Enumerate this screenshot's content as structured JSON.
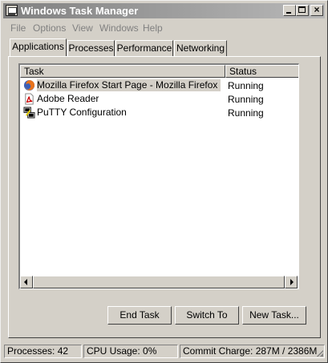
{
  "window": {
    "title": "Windows Task Manager"
  },
  "menu": [
    "File",
    "Options",
    "View",
    "Windows",
    "Help"
  ],
  "tabs": [
    "Applications",
    "Processes",
    "Performance",
    "Networking"
  ],
  "active_tab": "Applications",
  "list": {
    "columns": [
      "Task",
      "Status"
    ],
    "rows": [
      {
        "task": "Mozilla Firefox Start Page - Mozilla Firefox",
        "status": "Running",
        "icon": "firefox-icon",
        "selected": true
      },
      {
        "task": "Adobe Reader",
        "status": "Running",
        "icon": "adobe-reader-icon",
        "selected": false
      },
      {
        "task": "PuTTY Configuration",
        "status": "Running",
        "icon": "putty-icon",
        "selected": false
      }
    ]
  },
  "buttons": {
    "end_task": "End Task",
    "switch_to": "Switch To",
    "new_task": "New Task..."
  },
  "statusbar": {
    "processes": "Processes: 42",
    "cpu": "CPU Usage: 0%",
    "commit": "Commit Charge: 287M / 2386M"
  },
  "colors": {
    "titlebar_start": "#808080",
    "titlebar_end": "#b8b8b8",
    "face": "#d4d0c8"
  }
}
